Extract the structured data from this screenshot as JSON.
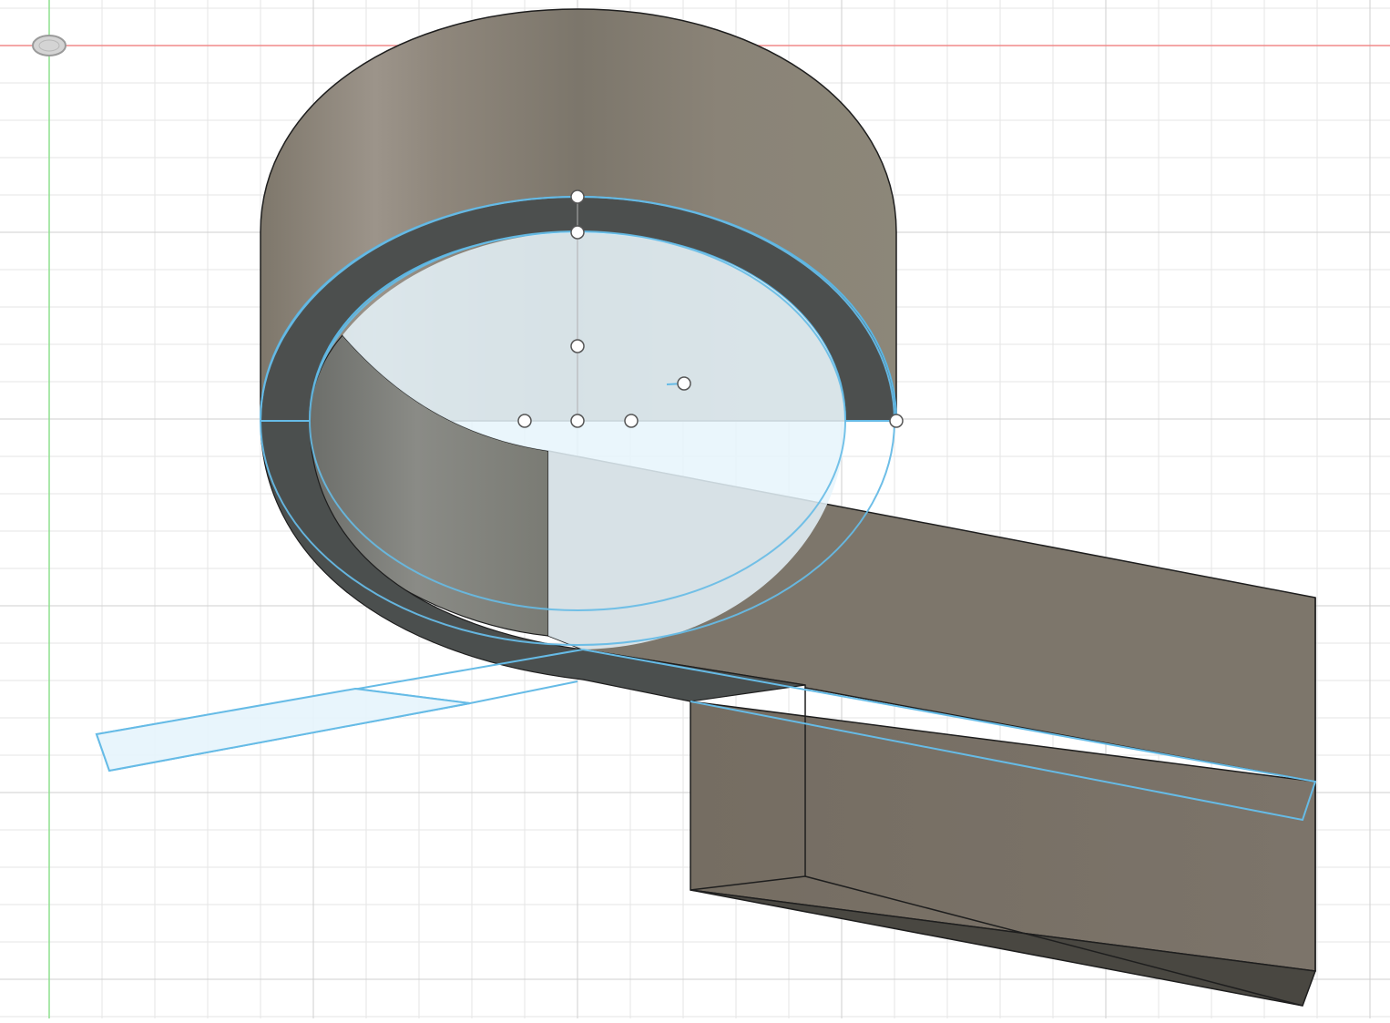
{
  "app": {
    "view": "cad-3d-viewport"
  },
  "viewport": {
    "background": "#ffffff",
    "grid_minor_color": "#e6e6e6",
    "grid_major_color": "#cfcfcf",
    "x_axis_color": "#f08a8a",
    "y_axis_color": "#8ee08e",
    "origin_icon": "origin-ellipse-icon"
  },
  "model": {
    "body_color": "#7d766c",
    "body_dark_color": "#4a4c4c",
    "body_bottom_color": "#494741",
    "selection_color": "#66bbe6",
    "selection_fill": "#e6f4fc",
    "edge_color": "#1e1e1e"
  },
  "sketch": {
    "handles": [
      "top-outer-point",
      "top-inner-point",
      "center-upper-point",
      "radius-drag-point",
      "center-left-point",
      "center-point",
      "center-right-point",
      "rim-right-point"
    ]
  }
}
